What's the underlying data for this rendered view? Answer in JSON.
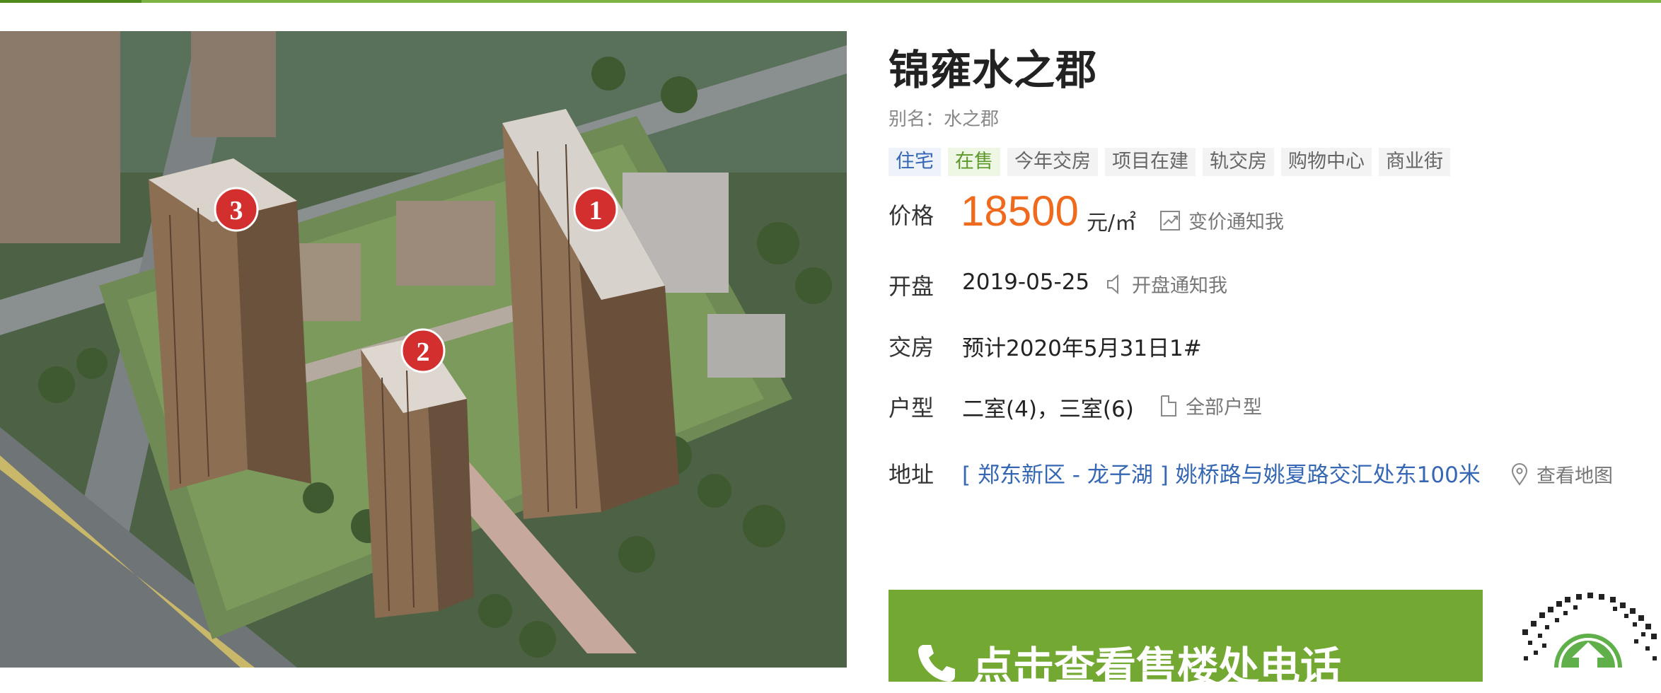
{
  "project": {
    "title": "锦雍水之郡",
    "alias": "别名：水之郡",
    "tags": [
      {
        "label": "住宅",
        "style": "blue"
      },
      {
        "label": "在售",
        "style": "green"
      },
      {
        "label": "今年交房",
        "style": "gray"
      },
      {
        "label": "项目在建",
        "style": "gray"
      },
      {
        "label": "轨交房",
        "style": "gray"
      },
      {
        "label": "购物中心",
        "style": "gray"
      },
      {
        "label": "商业街",
        "style": "gray"
      }
    ]
  },
  "price": {
    "label": "价格",
    "value": "18500",
    "unit": "元/㎡",
    "notify": "变价通知我"
  },
  "opening": {
    "label": "开盘",
    "value": "2019-05-25",
    "notify": "开盘通知我"
  },
  "delivery": {
    "label": "交房",
    "value": "预计2020年5月31日1#"
  },
  "layout": {
    "label": "户型",
    "value": "二室(4)，三室(6)",
    "link": "全部户型"
  },
  "address": {
    "label": "地址",
    "value": "[ 郑东新区 - 龙子湖 ] 姚桥路与姚夏路交汇处东100米",
    "map_link": "查看地图"
  },
  "cta": {
    "label": "点击查看售楼处电话"
  },
  "image": {
    "markers": [
      "1",
      "2",
      "3"
    ]
  },
  "colors": {
    "accent": "#7cb342",
    "price": "#f06a1e",
    "link": "#3567b4",
    "marker": "#d32f2f"
  }
}
